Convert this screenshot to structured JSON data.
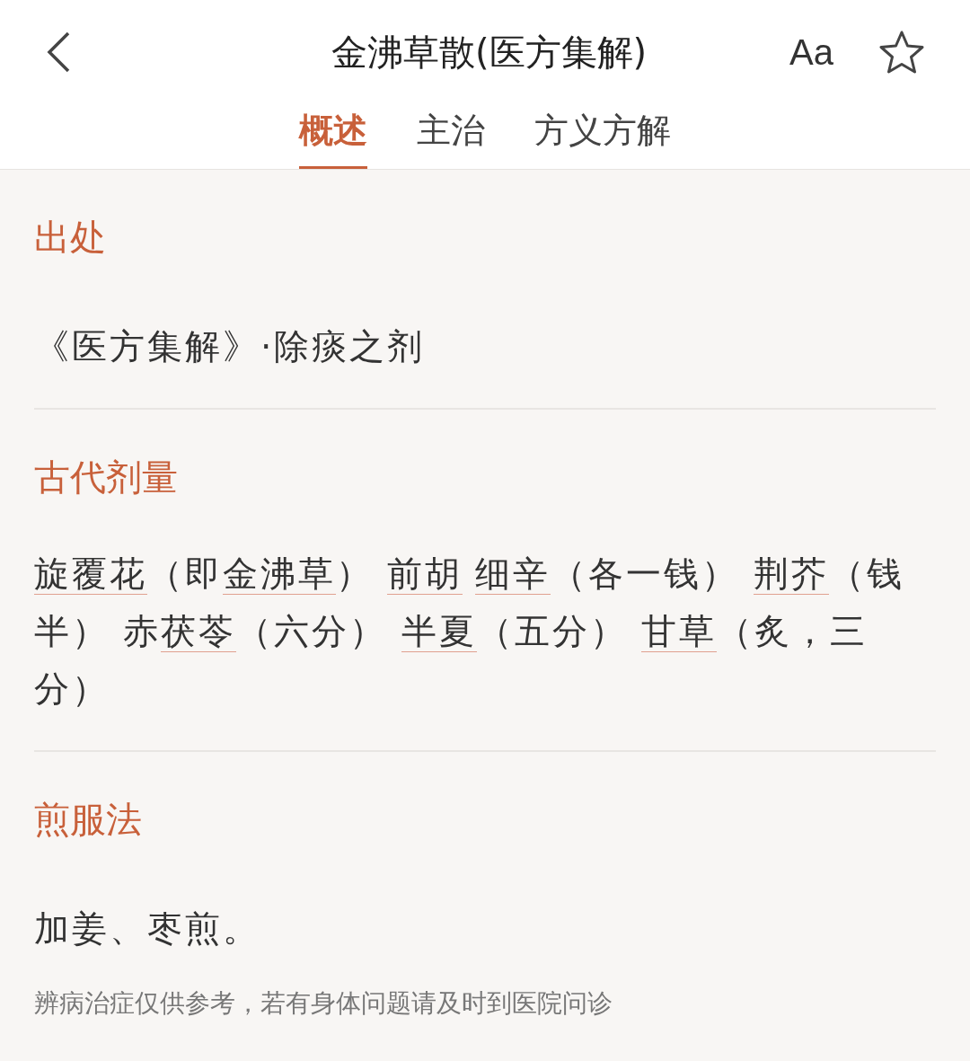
{
  "header": {
    "title": "金沸草散(医方集解)",
    "font_button": "Aa",
    "favorited": false
  },
  "tabs": [
    {
      "label": "概述",
      "selected": true
    },
    {
      "label": "主治",
      "selected": false
    },
    {
      "label": "方义方解",
      "selected": false
    }
  ],
  "sections": [
    {
      "title": "出处",
      "kind": "text",
      "text": "《医方集解》·除痰之剂"
    },
    {
      "title": "古代剂量",
      "kind": "herbs",
      "segments": [
        {
          "text": "旋覆花",
          "link": true
        },
        {
          "text": "（即",
          "link": false
        },
        {
          "text": "金沸草",
          "link": true
        },
        {
          "text": "） ",
          "link": false
        },
        {
          "text": "前胡",
          "link": true
        },
        {
          "text": "细辛",
          "link": true
        },
        {
          "text": "（各一钱） ",
          "link": false
        },
        {
          "text": "荆芥",
          "link": true
        },
        {
          "text": "（钱半） 赤",
          "link": false
        },
        {
          "text": "茯苓",
          "link": true
        },
        {
          "text": "（六分） ",
          "link": false
        },
        {
          "text": "半夏",
          "link": true
        },
        {
          "text": "（五分） ",
          "link": false
        },
        {
          "text": "甘草",
          "link": true
        },
        {
          "text": "（炙，三分）",
          "link": false
        }
      ]
    },
    {
      "title": "煎服法",
      "kind": "text",
      "text": "加姜、枣煎。"
    }
  ],
  "disclaimer": "辨病治症仅供参考，若有身体问题请及时到医院问诊"
}
